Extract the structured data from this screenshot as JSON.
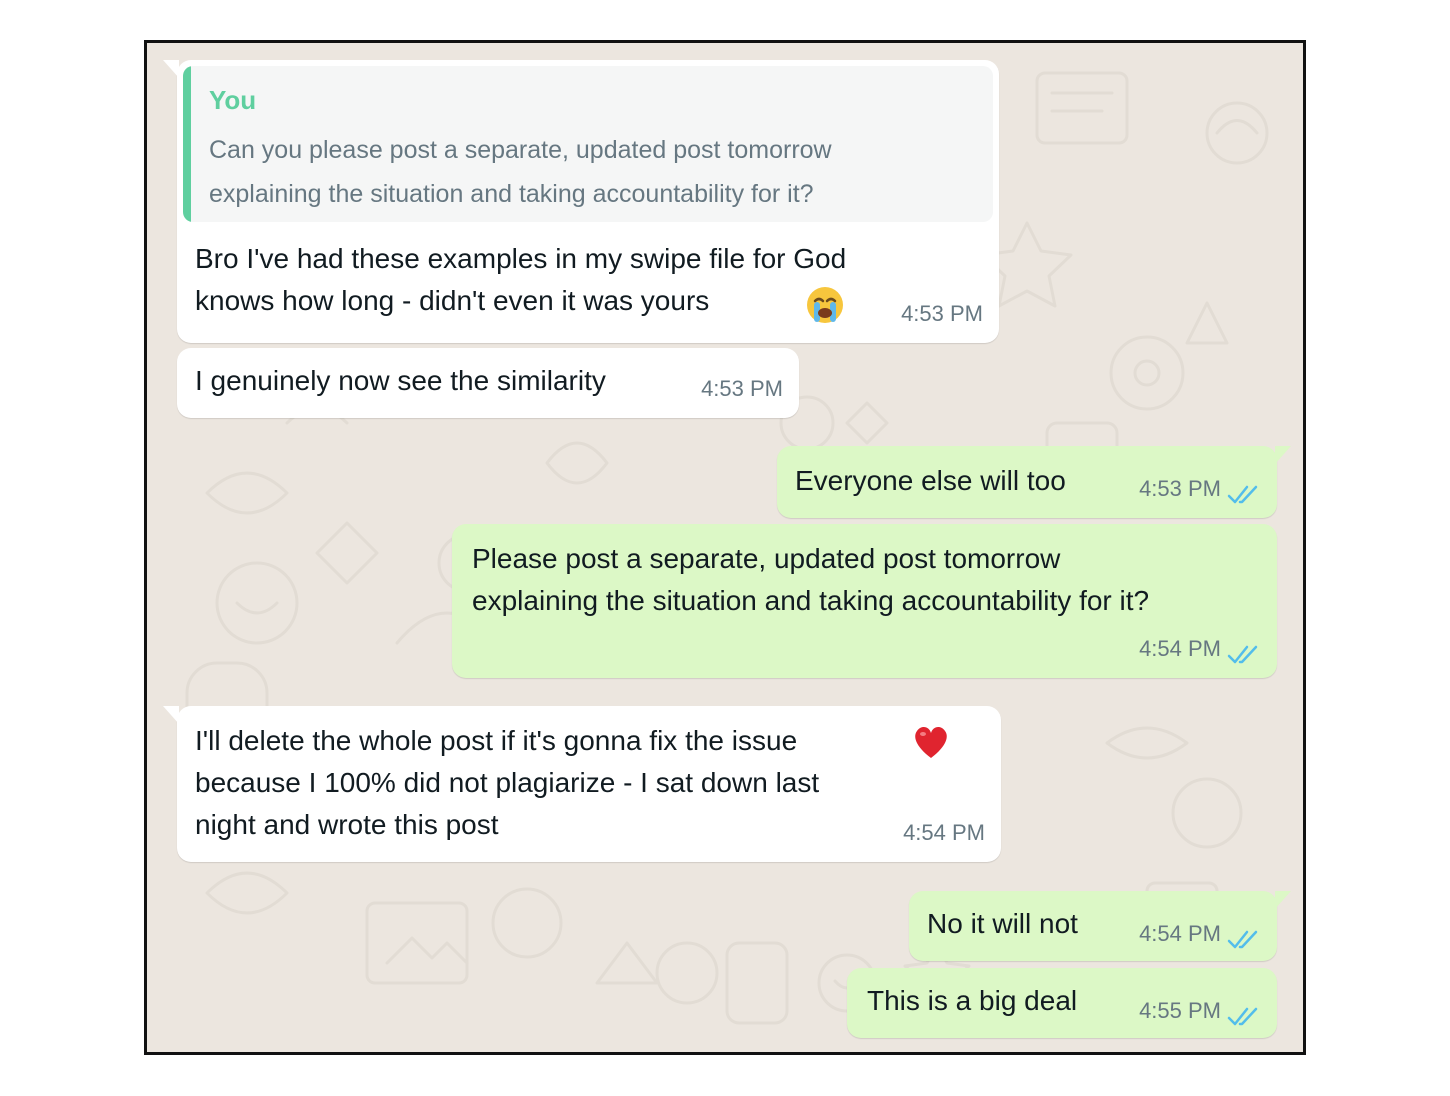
{
  "colors": {
    "chat_background": "#ece6df",
    "incoming_bubble": "#ffffff",
    "outgoing_bubble": "#dcf8c6",
    "quote_accent": "#5fcf9f",
    "read_ticks": "#53bdeb",
    "timestamp": "#667781"
  },
  "messages": [
    {
      "direction": "incoming",
      "quote": {
        "author": "You",
        "text": "Can you please post a separate, updated post tomorrow\nexplaining the situation and taking accountability for it?"
      },
      "text": "Bro I've had these examples in my swipe file for God\nknows how long - didn't even it was yours",
      "emoji": "loudly-crying-face",
      "time": "4:53 PM"
    },
    {
      "direction": "incoming",
      "text": "I genuinely now see the similarity",
      "time": "4:53 PM"
    },
    {
      "direction": "outgoing",
      "text": "Everyone else will too",
      "time": "4:53 PM",
      "status": "read"
    },
    {
      "direction": "outgoing",
      "text": "Please post a separate, updated post tomorrow\nexplaining the situation and taking accountability for it?",
      "time": "4:54 PM",
      "status": "read"
    },
    {
      "direction": "incoming",
      "text": "I'll delete the whole post if it's gonna fix the issue\nbecause I 100% did not plagiarize - I sat down last\nnight and wrote this post",
      "emoji": "red-heart",
      "time": "4:54 PM"
    },
    {
      "direction": "outgoing",
      "text": "No it will not",
      "time": "4:54 PM",
      "status": "read"
    },
    {
      "direction": "outgoing",
      "text": "This is a big deal",
      "time": "4:55 PM",
      "status": "read"
    }
  ]
}
